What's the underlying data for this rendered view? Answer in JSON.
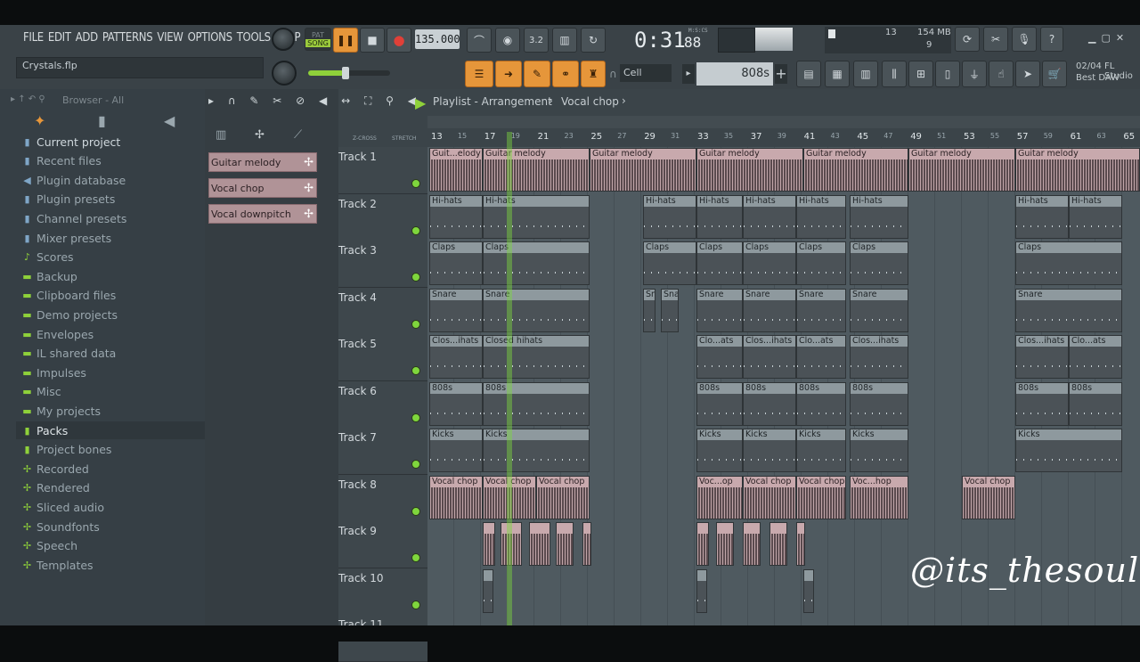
{
  "menu": [
    "FILE",
    "EDIT",
    "ADD",
    "PATTERNS",
    "VIEW",
    "OPTIONS",
    "TOOLS",
    "HELP"
  ],
  "project": {
    "file": "Crystals.flp"
  },
  "transport": {
    "pat": "PAT",
    "song": "SONG",
    "tempo": "135.000",
    "time": "0:31",
    "time_small": "88",
    "msc": "M:S:CS"
  },
  "cpu": {
    "value": "13",
    "mem": "154 MB",
    "poly": "9"
  },
  "snap": {
    "label": "Cell"
  },
  "channel_selector": {
    "label": "808s"
  },
  "news": {
    "date": "02/04",
    "brand": "FL Studio",
    "title": "Best DAW"
  },
  "browser": {
    "title": "Browser - All",
    "items": [
      {
        "label": "Current project",
        "icon": "project-icon"
      },
      {
        "label": "Recent files",
        "icon": "recent-icon"
      },
      {
        "label": "Plugin database",
        "icon": "plugin-icon"
      },
      {
        "label": "Plugin presets",
        "icon": "preset-icon"
      },
      {
        "label": "Channel presets",
        "icon": "preset-icon"
      },
      {
        "label": "Mixer presets",
        "icon": "preset-icon"
      },
      {
        "label": "Scores",
        "icon": "note-icon"
      },
      {
        "label": "Backup",
        "icon": "folder-icon"
      },
      {
        "label": "Clipboard files",
        "icon": "folder-icon"
      },
      {
        "label": "Demo projects",
        "icon": "folder-icon"
      },
      {
        "label": "Envelopes",
        "icon": "folder-icon"
      },
      {
        "label": "IL shared data",
        "icon": "folder-icon"
      },
      {
        "label": "Impulses",
        "icon": "folder-icon"
      },
      {
        "label": "Misc",
        "icon": "folder-icon"
      },
      {
        "label": "My projects",
        "icon": "folder-icon"
      },
      {
        "label": "Packs",
        "icon": "packs-icon"
      },
      {
        "label": "Project bones",
        "icon": "project-icon"
      },
      {
        "label": "Recorded",
        "icon": "plus-icon"
      },
      {
        "label": "Rendered",
        "icon": "plus-icon"
      },
      {
        "label": "Sliced audio",
        "icon": "plus-icon"
      },
      {
        "label": "Soundfonts",
        "icon": "plus-icon"
      },
      {
        "label": "Speech",
        "icon": "plus-icon"
      },
      {
        "label": "Templates",
        "icon": "plus-icon"
      }
    ]
  },
  "patterns": [
    "Guitar melody",
    "Vocal chop",
    "Vocal downpitch"
  ],
  "playlist": {
    "title": "Playlist - Arrangement",
    "pattern": "Vocal chop",
    "zcross": "Z-CROSS",
    "stretch": "STRETCH",
    "ruler": [
      "13",
      "15",
      "17",
      "19",
      "21",
      "23",
      "25",
      "27",
      "29",
      "31",
      "33",
      "35",
      "37",
      "39",
      "41",
      "43",
      "45",
      "47",
      "49",
      "51",
      "53",
      "55",
      "57",
      "59",
      "61",
      "63",
      "65"
    ],
    "tracks": [
      "Track 1",
      "Track 2",
      "Track 3",
      "Track 4",
      "Track 5",
      "Track 6",
      "Track 7",
      "Track 8",
      "Track 9",
      "Track 10",
      "Track 11"
    ]
  },
  "clips": {
    "t1": [
      "Guit...elody",
      "Guitar melody",
      "Guitar melody",
      "Guitar melody",
      "Guitar melody",
      "Guitar melody",
      "Guitar melody"
    ],
    "t2": "Hi-hats",
    "t3": "Claps",
    "t4": "Snare",
    "t5": [
      "Clos...ihats",
      "Closed hihats",
      "Clo...ats",
      "Clos...ihats",
      "Clo...ats",
      "Clos...ihats",
      "Clos...ihats",
      "Clo...ats"
    ],
    "t6": "808s",
    "t7": "Kicks",
    "t8": [
      "Vocal chop",
      "Vocal chop",
      "Vocal chop",
      "Voc...op",
      "Vocal chop",
      "Vocal chop",
      "Voc...hop",
      "Vocal chop"
    ]
  },
  "watermark": "@its_thesoul"
}
